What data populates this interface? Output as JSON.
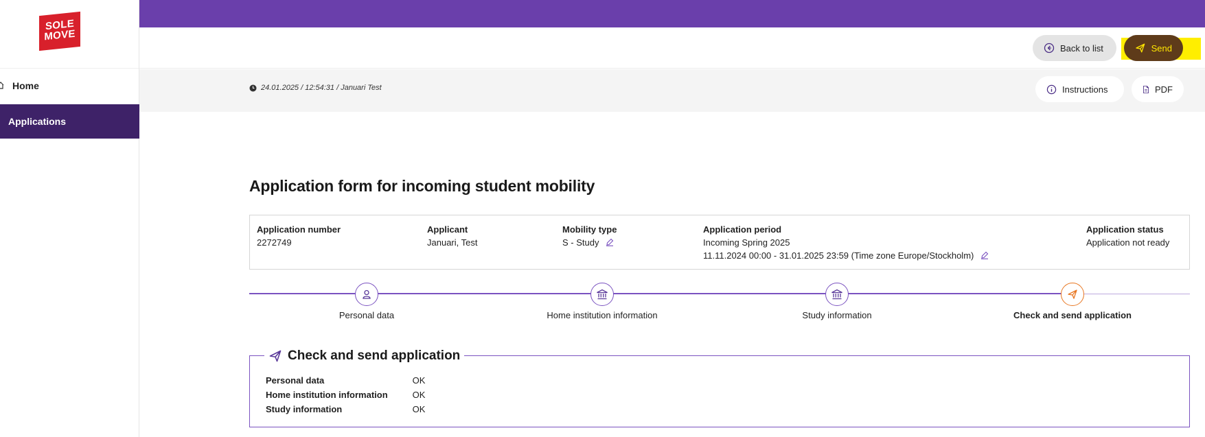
{
  "logo": {
    "line1": "SOLE",
    "line2": "MOVE"
  },
  "sidebar": {
    "items": [
      {
        "label": "Home",
        "icon": "home-icon",
        "active": false
      },
      {
        "label": "Applications",
        "active": true
      }
    ]
  },
  "colors": {
    "topbar": "#6a3fab",
    "active_nav": "#3e2268",
    "accent": "#7a52c0",
    "active_step": "#e87722",
    "highlight": "#ffee00"
  },
  "toolbar": {
    "back_label": "Back to list",
    "send_label": "Send",
    "instructions_label": "Instructions",
    "pdf_label": "PDF",
    "timestamp": "24.01.2025 / 12:54:31 / Januari Test"
  },
  "page": {
    "title": "Application form for incoming student mobility"
  },
  "info": {
    "app_number_label": "Application number",
    "app_number": "2272749",
    "applicant_label": "Applicant",
    "applicant": "Januari, Test",
    "mobility_label": "Mobility type",
    "mobility": "S - Study",
    "period_label": "Application period",
    "period_name": "Incoming Spring 2025",
    "period_dates": "11.11.2024 00:00 - 31.01.2025 23:59 (Time zone Europe/Stockholm)",
    "status_label": "Application status",
    "status": "Application not ready"
  },
  "steps": [
    {
      "label": "Personal data",
      "icon": "person-icon"
    },
    {
      "label": "Home institution information",
      "icon": "institution-icon"
    },
    {
      "label": "Study information",
      "icon": "institution-icon"
    },
    {
      "label": "Check and send application",
      "icon": "send-icon",
      "active": true
    }
  ],
  "check": {
    "title": "Check and send application",
    "rows": [
      {
        "key": "Personal data",
        "value": "OK"
      },
      {
        "key": "Home institution information",
        "value": "OK"
      },
      {
        "key": "Study information",
        "value": "OK"
      }
    ]
  }
}
